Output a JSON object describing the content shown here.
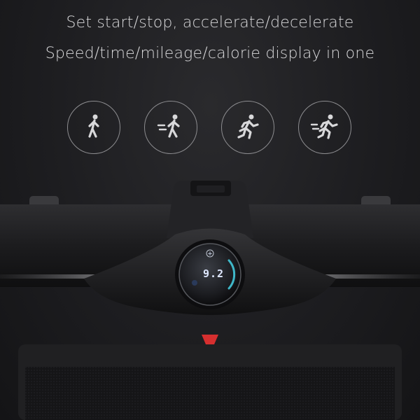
{
  "headline": {
    "line1": "Set start/stop, accelerate/decelerate",
    "line2": "Speed/time/mileage/calorie display in one"
  },
  "modes": [
    {
      "icon": "walk-icon"
    },
    {
      "icon": "walk-fast-icon"
    },
    {
      "icon": "run-icon"
    },
    {
      "icon": "run-fast-icon"
    }
  ],
  "display": {
    "value": "9.2",
    "plus_symbol": "+"
  },
  "colors": {
    "background": "#1b1b1d",
    "text": "#d8d8da",
    "icon_stroke": "#8d8d90",
    "display_ring": "#3fb7c8",
    "tab_red": "#d62f2f"
  }
}
